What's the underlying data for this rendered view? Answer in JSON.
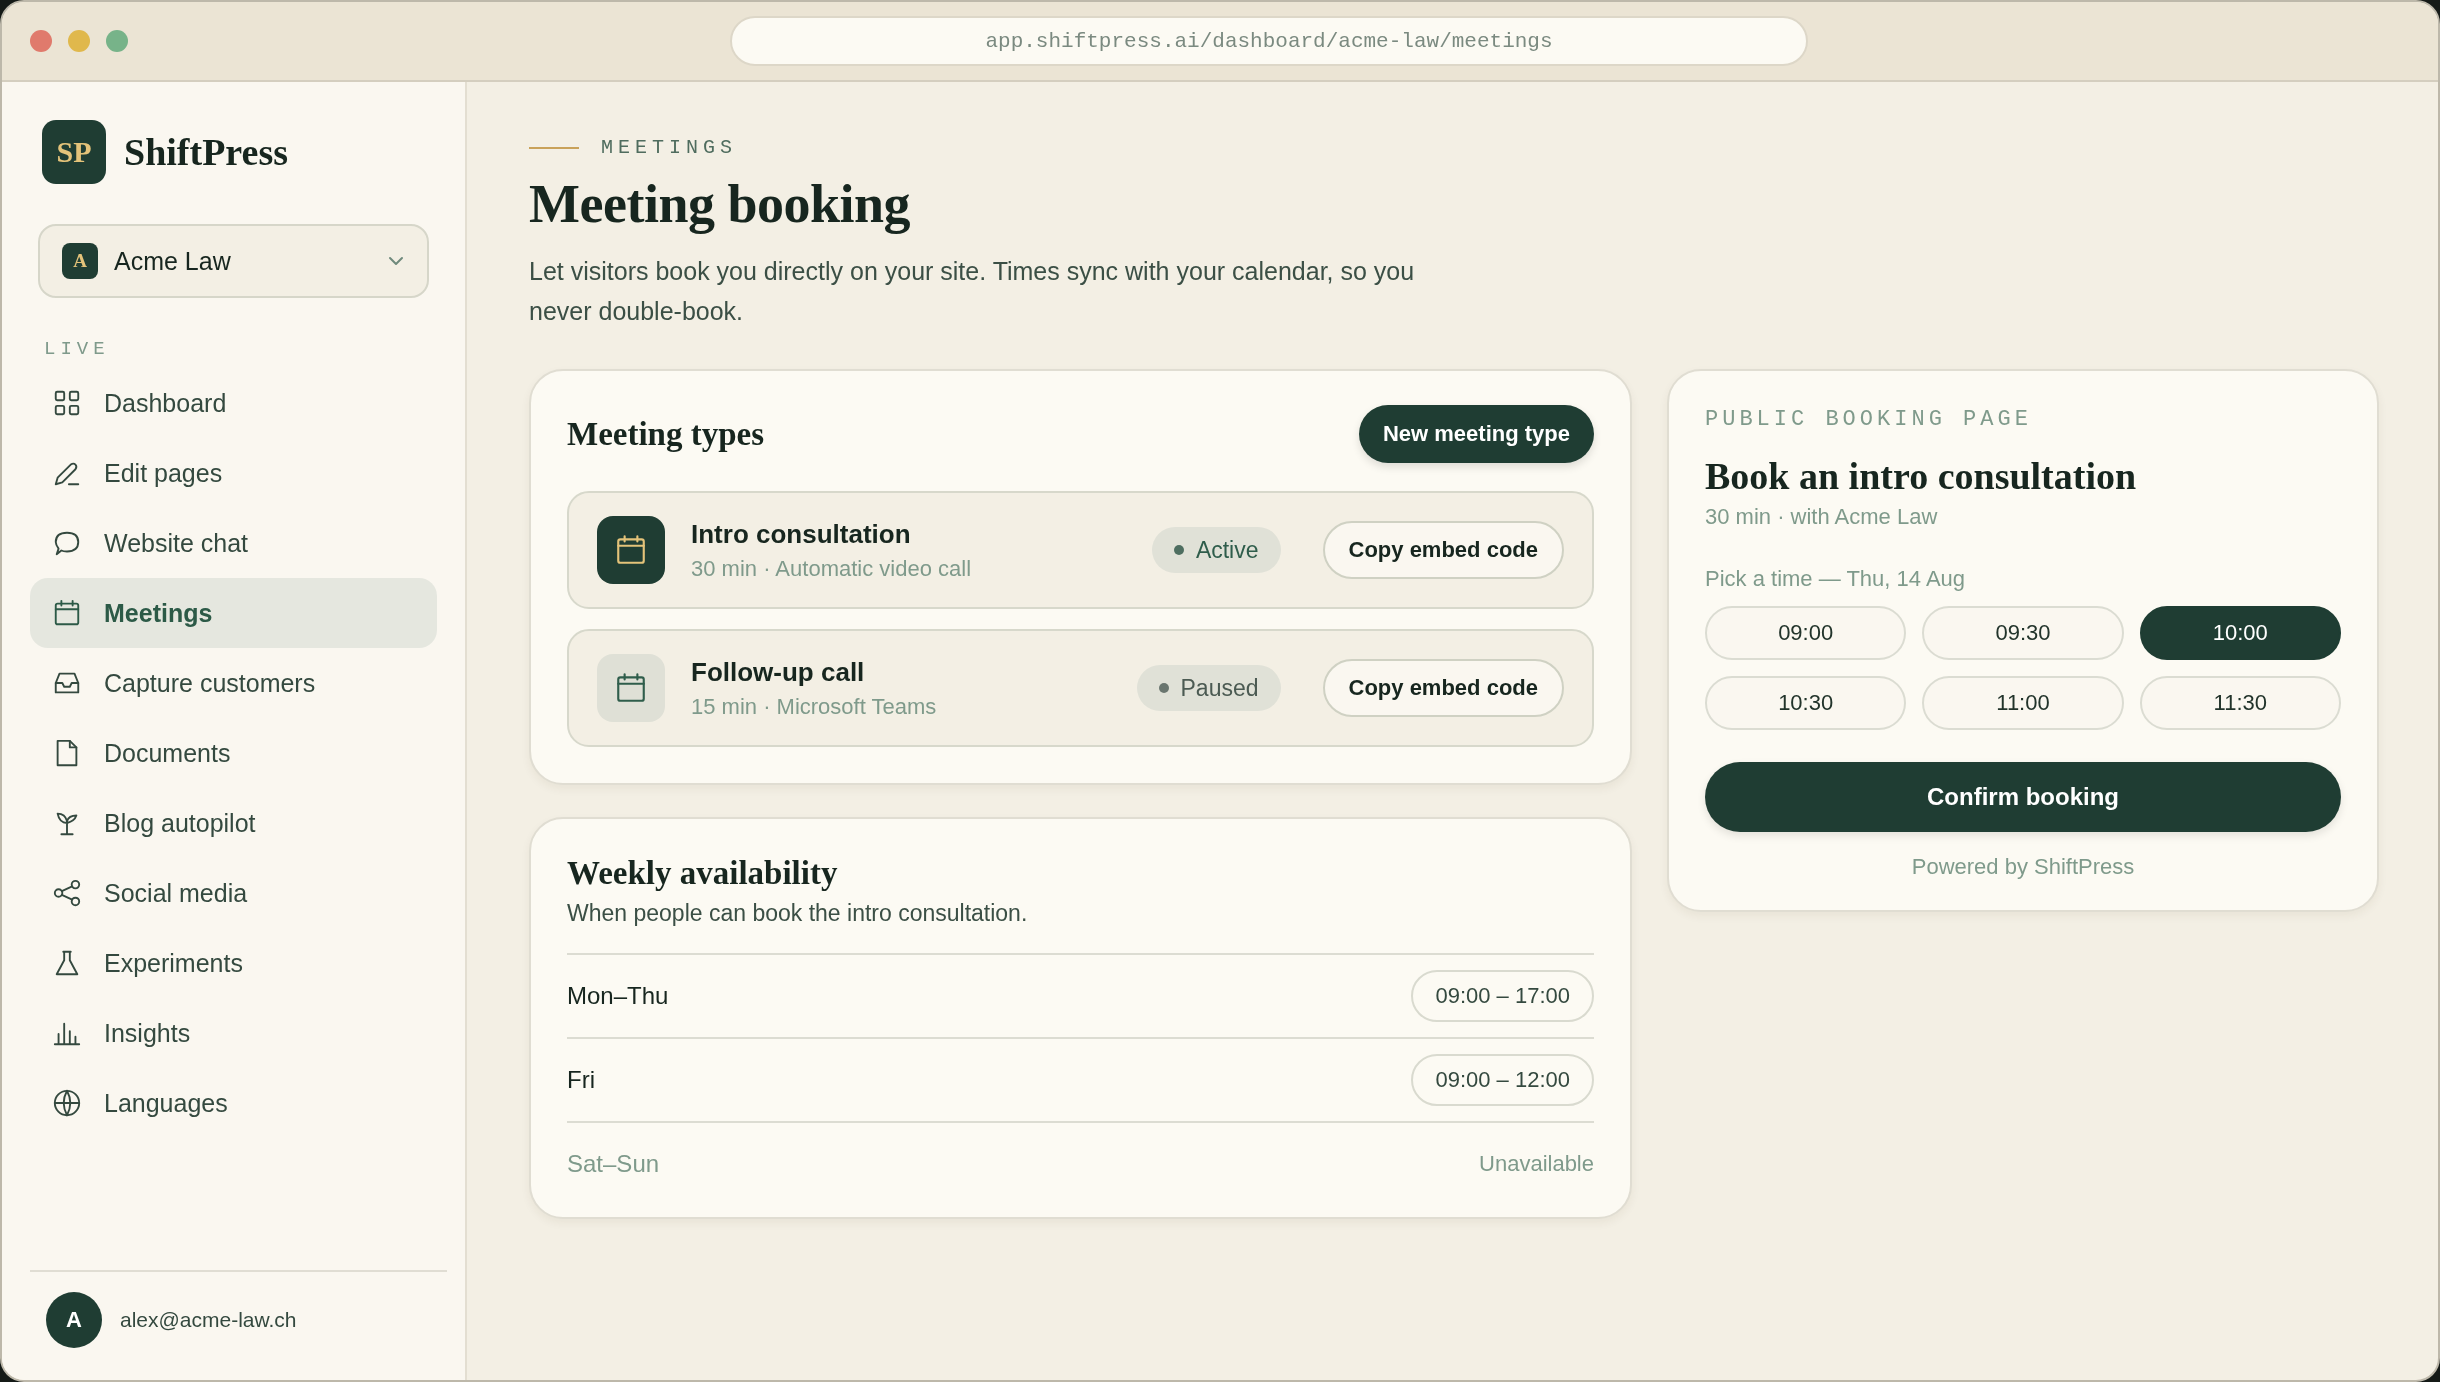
{
  "browser": {
    "url": "app.shiftpress.ai/dashboard/acme-law/meetings"
  },
  "sidebar": {
    "logo_mark": "SP",
    "brand": "ShiftPress",
    "workspace": {
      "initial": "A",
      "name": "Acme Law"
    },
    "section_label": "LIVE",
    "items": [
      {
        "label": "Dashboard",
        "selected": false
      },
      {
        "label": "Edit pages",
        "selected": false
      },
      {
        "label": "Website chat",
        "selected": false
      },
      {
        "label": "Meetings",
        "selected": true
      },
      {
        "label": "Capture customers",
        "selected": false
      },
      {
        "label": "Documents",
        "selected": false
      },
      {
        "label": "Blog autopilot",
        "selected": false
      },
      {
        "label": "Social media",
        "selected": false
      },
      {
        "label": "Experiments",
        "selected": false
      },
      {
        "label": "Insights",
        "selected": false
      },
      {
        "label": "Languages",
        "selected": false
      }
    ],
    "user": {
      "initial": "A",
      "email": "alex@acme-law.ch"
    }
  },
  "header": {
    "eyebrow": "MEETINGS",
    "title": "Meeting booking",
    "description": "Let visitors book you directly on your site. Times sync with your calendar, so you never double-book."
  },
  "meeting_types": {
    "title": "Meeting types",
    "new_button": "New meeting type",
    "items": [
      {
        "name": "Intro consultation",
        "details": "30 min · Automatic video call",
        "status": "Active",
        "active": true,
        "action": "Copy embed code"
      },
      {
        "name": "Follow-up call",
        "details": "15 min · Microsoft Teams",
        "status": "Paused",
        "active": false,
        "action": "Copy embed code"
      }
    ]
  },
  "availability": {
    "title": "Weekly availability",
    "subtitle": "When people can book the intro consultation.",
    "rows": [
      {
        "days": "Mon–Thu",
        "hours": "09:00 – 17:00",
        "available": true
      },
      {
        "days": "Fri",
        "hours": "09:00 – 12:00",
        "available": true
      },
      {
        "days": "Sat–Sun",
        "hours": "Unavailable",
        "available": false
      }
    ]
  },
  "booking": {
    "eyebrow": "PUBLIC BOOKING PAGE",
    "title": "Book an intro consultation",
    "subtitle": "30 min · with Acme Law",
    "prompt": "Pick a time — Thu, 14 Aug",
    "slots": [
      {
        "time": "09:00",
        "selected": false
      },
      {
        "time": "09:30",
        "selected": false
      },
      {
        "time": "10:00",
        "selected": true
      },
      {
        "time": "10:30",
        "selected": false
      },
      {
        "time": "11:00",
        "selected": false
      },
      {
        "time": "11:30",
        "selected": false
      }
    ],
    "confirm": "Confirm booking",
    "footer": "Powered by ShiftPress"
  }
}
